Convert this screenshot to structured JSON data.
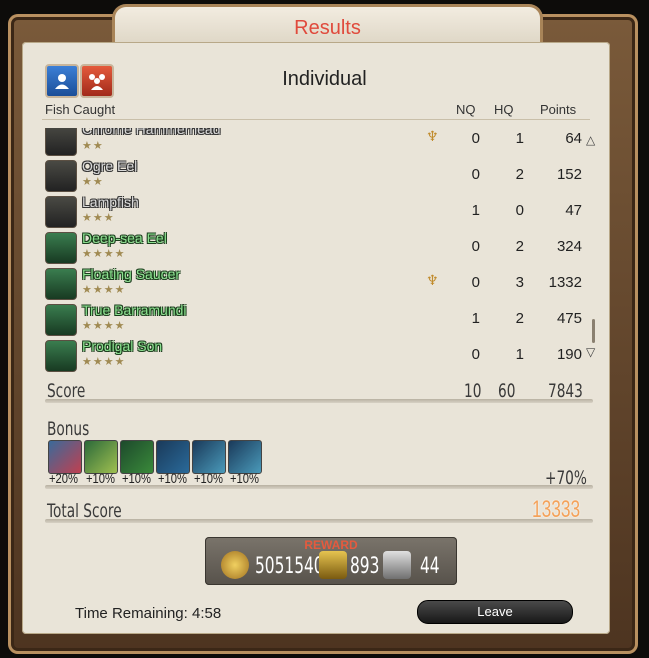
{
  "window": {
    "title": "Results"
  },
  "tabs": {
    "active": "Individual"
  },
  "columns": {
    "fish": "Fish Caught",
    "nq": "NQ",
    "hq": "HQ",
    "points": "Points"
  },
  "fish": [
    {
      "name": "Chrome Hammerhead",
      "stars": "★★",
      "nq": "0",
      "hq": "1",
      "points": "64",
      "tag": "♆"
    },
    {
      "name": "Ogre Eel",
      "stars": "★★",
      "nq": "0",
      "hq": "2",
      "points": "152"
    },
    {
      "name": "Lampfish",
      "stars": "★★★",
      "nq": "1",
      "hq": "0",
      "points": "47"
    },
    {
      "name": "Deep-sea Eel",
      "stars": "★★★★",
      "nq": "0",
      "hq": "2",
      "points": "324"
    },
    {
      "name": "Floating Saucer",
      "stars": "★★★★",
      "nq": "0",
      "hq": "3",
      "points": "1332",
      "tag": "♆"
    },
    {
      "name": "True Barramundi",
      "stars": "★★★★",
      "nq": "1",
      "hq": "2",
      "points": "475"
    },
    {
      "name": "Prodigal Son",
      "stars": "★★★★",
      "nq": "0",
      "hq": "1",
      "points": "190"
    }
  ],
  "score": {
    "label": "Score",
    "nq": "10",
    "hq": "60",
    "points": "7843"
  },
  "bonus": {
    "label": "Bonus",
    "items": [
      "+20%",
      "+10%",
      "+10%",
      "+10%",
      "+10%",
      "+10%"
    ],
    "total": "+70%"
  },
  "total_score": {
    "label": "Total Score",
    "value": "13333"
  },
  "reward": {
    "label": "REWARD",
    "gil": "5051540",
    "scrips": "893",
    "seals": "44"
  },
  "footer": {
    "time_remaining": "Time Remaining: 4:58",
    "leave": "Leave"
  }
}
